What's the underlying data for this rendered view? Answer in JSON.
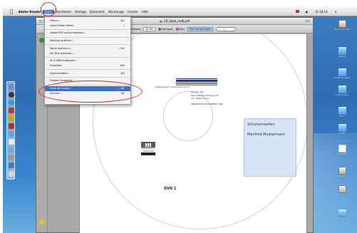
{
  "menubar": {
    "app_name": "Adobe Reader",
    "menus": [
      "Datei",
      "Bearbeiten",
      "Anzeige",
      "Dokument",
      "Werkzeuge",
      "Fenster",
      "Hilfe"
    ],
    "active_menu": "Datei",
    "clock": "Di 18:14"
  },
  "window": {
    "title": "CD_label_mdb.pdf",
    "toolbar": {
      "zoom_value": "42,6%",
      "link_label": "Seite",
      "page_label": "Dokument",
      "tool_select": "Formular",
      "tool_text": "Text",
      "tool_highlight": "Text hervorheben",
      "search_placeholder": "Suchen"
    }
  },
  "file_menu": {
    "items": [
      {
        "label": "Öffnen...",
        "shortcut": "⌘O",
        "disabled": false,
        "selected": false
      },
      {
        "label": "Letzte Datei öffnen",
        "shortcut": "▸",
        "disabled": false,
        "selected": false
      },
      {
        "label": "Adobe PDF online erstellen...",
        "shortcut": "",
        "disabled": false,
        "selected": false
      },
      {
        "label": "Meeting eröffnen...",
        "shortcut": "",
        "disabled": false,
        "selected": false
      },
      {
        "label": "Kopie speichern...",
        "shortcut": "⇧⌘S",
        "disabled": false,
        "selected": false
      },
      {
        "label": "Als Text speichern...",
        "shortcut": "",
        "disabled": false,
        "selected": false
      },
      {
        "label": "An E-Mail anhängen...",
        "shortcut": "",
        "disabled": false,
        "selected": false
      },
      {
        "label": "Schließen",
        "shortcut": "⌘W",
        "disabled": false,
        "selected": false
      },
      {
        "label": "Eigenschaften...",
        "shortcut": "⌘D",
        "disabled": false,
        "selected": false
      },
      {
        "label": "Digitale Ausgaben",
        "shortcut": "",
        "disabled": false,
        "selected": false
      },
      {
        "label": "Seite einrichten...",
        "shortcut": "⇧⌘P",
        "disabled": false,
        "selected": true
      },
      {
        "label": "Drucken...",
        "shortcut": "⌘P",
        "disabled": false,
        "selected": false
      }
    ]
  },
  "page": {
    "tagline": "pädagogische hochschule zürich",
    "address_line1": "Hardein tab",
    "address_line2": "Stampfenbachstrasse 121",
    "address_line3": "CH - 8090 Zürich",
    "website": "www.phzh.ch/medien-tab",
    "school_name": "Schulternsehen",
    "person_name": "Manfred Mustermann",
    "logo_middle": "Pädagogische",
    "logo_bottom": "Hochschule",
    "dvd_label": "DVD 1"
  },
  "desktop_icons": [
    {
      "name": "Macintosh HD",
      "kind": "drive"
    },
    {
      "name": "Geteilt",
      "kind": "folder"
    },
    {
      "name": "Medienprojekte",
      "kind": "folder"
    },
    {
      "name": "Dokumente",
      "kind": "folder"
    },
    {
      "name": "Kurs",
      "kind": "folder"
    },
    {
      "name": "Ablage",
      "kind": "folder"
    },
    {
      "name": "C_KAMPELI",
      "kind": "doc"
    },
    {
      "name": "DVD 1",
      "kind": "drive"
    },
    {
      "name": "DVD 2",
      "kind": "drive"
    },
    {
      "name": "kurs_aufträge",
      "kind": "folder"
    }
  ],
  "colors": {
    "menu_highlight": "#3b6fd1",
    "annotation_red": "#e0281c",
    "label_box": "#d8e3f6",
    "logo_navy": "#1b2a66"
  }
}
